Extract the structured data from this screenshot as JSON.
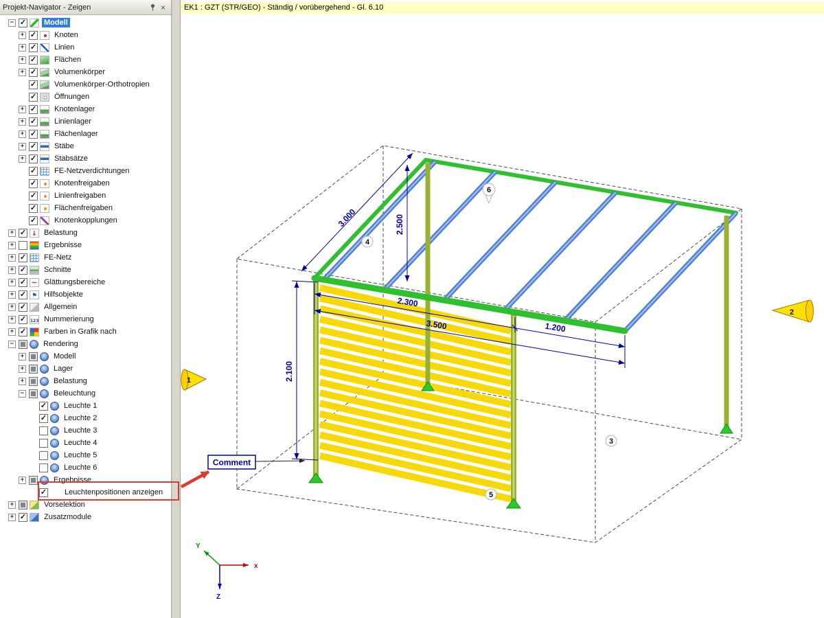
{
  "navigator": {
    "title": "Projekt-Navigator - Zeigen",
    "selection_color": "#2e7fd6",
    "items": [
      {
        "label": "Modell",
        "level": 0,
        "expand": "minus",
        "check": "checked",
        "icon": "model",
        "selected": true
      },
      {
        "label": "Knoten",
        "level": 1,
        "expand": "plus",
        "check": "checked",
        "icon": "nodes"
      },
      {
        "label": "Linien",
        "level": 1,
        "expand": "plus",
        "check": "checked",
        "icon": "lines"
      },
      {
        "label": "Flächen",
        "level": 1,
        "expand": "plus",
        "check": "checked",
        "icon": "surfaces"
      },
      {
        "label": "Volumenkörper",
        "level": 1,
        "expand": "plus",
        "check": "checked",
        "icon": "solids"
      },
      {
        "label": "Volumenkörper-Orthotropien",
        "level": 1,
        "expand": "none",
        "check": "checked",
        "icon": "solids"
      },
      {
        "label": "Öffnungen",
        "level": 1,
        "expand": "none",
        "check": "checked",
        "icon": "openings"
      },
      {
        "label": "Knotenlager",
        "level": 1,
        "expand": "plus",
        "check": "checked",
        "icon": "supports"
      },
      {
        "label": "Linienlager",
        "level": 1,
        "expand": "plus",
        "check": "checked",
        "icon": "supports"
      },
      {
        "label": "Flächenlager",
        "level": 1,
        "expand": "plus",
        "check": "checked",
        "icon": "supports"
      },
      {
        "label": "Stäbe",
        "level": 1,
        "expand": "plus",
        "check": "checked",
        "icon": "members"
      },
      {
        "label": "Stabsätze",
        "level": 1,
        "expand": "plus",
        "check": "checked",
        "icon": "members"
      },
      {
        "label": "FE-Netzverdichtungen",
        "level": 1,
        "expand": "none",
        "check": "checked",
        "icon": "mesh-refinement"
      },
      {
        "label": "Knotenfreigaben",
        "level": 1,
        "expand": "none",
        "check": "checked",
        "icon": "releases"
      },
      {
        "label": "Linienfreigaben",
        "level": 1,
        "expand": "none",
        "check": "checked",
        "icon": "releases"
      },
      {
        "label": "Flächenfreigaben",
        "level": 1,
        "expand": "none",
        "check": "checked",
        "icon": "releases"
      },
      {
        "label": "Knotenkopplungen",
        "level": 1,
        "expand": "none",
        "check": "checked",
        "icon": "couplings"
      },
      {
        "label": "Belastung",
        "level": 0,
        "expand": "plus",
        "check": "checked",
        "icon": "loads"
      },
      {
        "label": "Ergebnisse",
        "level": 0,
        "expand": "plus",
        "check": "unchecked",
        "icon": "results"
      },
      {
        "label": "FE-Netz",
        "level": 0,
        "expand": "plus",
        "check": "checked",
        "icon": "fe-mesh"
      },
      {
        "label": "Schnitte",
        "level": 0,
        "expand": "plus",
        "check": "checked",
        "icon": "sections"
      },
      {
        "label": "Glättungsbereiche",
        "level": 0,
        "expand": "plus",
        "check": "checked",
        "icon": "smoothing"
      },
      {
        "label": "Hilfsobjekte",
        "level": 0,
        "expand": "plus",
        "check": "checked",
        "icon": "guide-objects"
      },
      {
        "label": "Allgemein",
        "level": 0,
        "expand": "plus",
        "check": "checked",
        "icon": "general"
      },
      {
        "label": "Nummerierung",
        "level": 0,
        "expand": "plus",
        "check": "checked",
        "icon": "numbering"
      },
      {
        "label": "Farben in Grafik nach",
        "level": 0,
        "expand": "plus",
        "check": "checked",
        "icon": "colors"
      },
      {
        "label": "Rendering",
        "level": 0,
        "expand": "minus",
        "check": "indeterminate",
        "icon": "rendering"
      },
      {
        "label": "Modell",
        "level": 1,
        "expand": "plus",
        "check": "indeterminate",
        "icon": "rendering"
      },
      {
        "label": "Lager",
        "level": 1,
        "expand": "plus",
        "check": "indeterminate",
        "icon": "rendering"
      },
      {
        "label": "Belastung",
        "level": 1,
        "expand": "plus",
        "check": "indeterminate",
        "icon": "rendering"
      },
      {
        "label": "Beleuchtung",
        "level": 1,
        "expand": "minus",
        "check": "indeterminate",
        "icon": "rendering"
      },
      {
        "label": "Leuchte 1",
        "level": 2,
        "expand": "none",
        "check": "checked",
        "icon": "lamp"
      },
      {
        "label": "Leuchte 2",
        "level": 2,
        "expand": "none",
        "check": "checked",
        "icon": "lamp"
      },
      {
        "label": "Leuchte 3",
        "level": 2,
        "expand": "none",
        "check": "unchecked",
        "icon": "lamp"
      },
      {
        "label": "Leuchte 4",
        "level": 2,
        "expand": "none",
        "check": "unchecked",
        "icon": "lamp"
      },
      {
        "label": "Leuchte 5",
        "level": 2,
        "expand": "none",
        "check": "unchecked",
        "icon": "lamp"
      },
      {
        "label": "Leuchte 6",
        "level": 2,
        "expand": "none",
        "check": "unchecked",
        "icon": "lamp"
      },
      {
        "label": "Ergebnisse",
        "level": 1,
        "expand": "plus",
        "check": "indeterminate",
        "icon": "rendering"
      },
      {
        "label": "Leuchtenpositionen anzeigen",
        "level": 2,
        "expand": "none",
        "check": "checked",
        "icon": "none",
        "boxed": true
      },
      {
        "label": "Vorselektion",
        "level": 0,
        "expand": "plus",
        "check": "indeterminate",
        "icon": "preselection"
      },
      {
        "label": "Zusatzmodule",
        "level": 0,
        "expand": "plus",
        "check": "checked",
        "icon": "modules"
      }
    ]
  },
  "viewport": {
    "header": "EK1 : GZT (STR/GEO) - Ständig / vorübergehend - Gl. 6.10",
    "header_bg": "#ffffc2",
    "comment_label": "Comment",
    "dimensions": {
      "wall_height": "2.100",
      "roof_depth": "3.000",
      "clear_height": "2.500",
      "bay_width": "2.300",
      "total_width": "3.500",
      "overhang": "1.200"
    },
    "node_labels": {
      "n1": "1",
      "n2": "2",
      "n3": "3",
      "n4": "4",
      "n5": "5",
      "n6": "6"
    },
    "lights": [
      {
        "label": "1"
      },
      {
        "label": "2"
      }
    ],
    "axes": {
      "x": "x",
      "y": "Y",
      "z": "Z"
    },
    "counts": {
      "louvers": 17,
      "rafters": 6
    },
    "colors": {
      "beam_green": "#2fbf2f",
      "rafter_blue": "#4d7fce",
      "rafter_highlight": "#9cb9ea",
      "louver_yellow": "#f5d90a",
      "column_olive": "#97b232",
      "column_highlight": "#c9da6e",
      "support_green": "#2dc82d",
      "dimension_blue": "#0000a0",
      "annotation_red": "#e03a2f",
      "light_yellow": "#ffe000"
    }
  }
}
